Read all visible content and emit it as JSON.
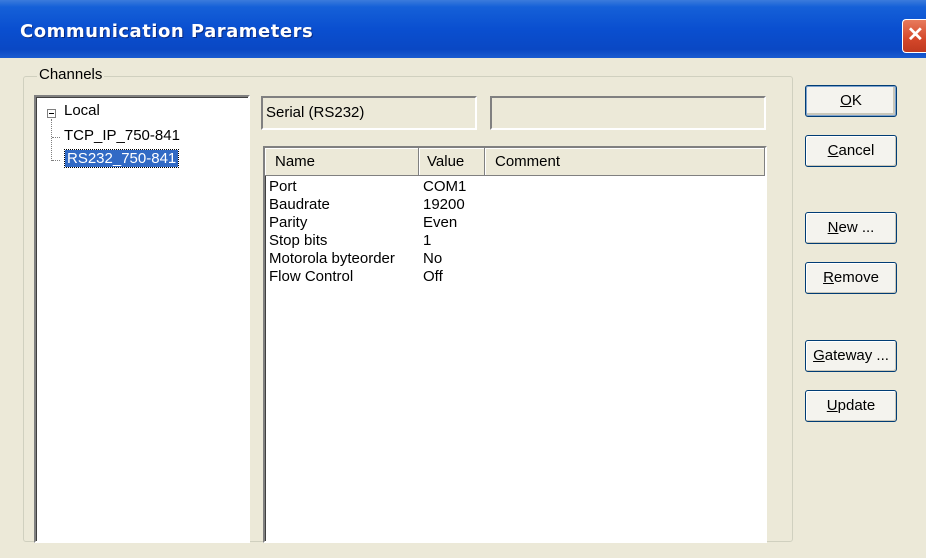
{
  "window": {
    "title": "Communication Parameters"
  },
  "channels": {
    "legend": "Channels",
    "tree": [
      {
        "label": "Local",
        "level": 0,
        "expanded": true
      },
      {
        "label": "TCP_IP_750-841",
        "level": 1
      },
      {
        "label": "RS232_750-841",
        "level": 1,
        "selected": true
      }
    ]
  },
  "detail": {
    "channel_type": "Serial (RS232)",
    "channel_info": "",
    "columns": [
      "Name",
      "Value",
      "Comment"
    ],
    "rows": [
      {
        "name": "Port",
        "value": "COM1",
        "comment": ""
      },
      {
        "name": "Baudrate",
        "value": "19200",
        "comment": ""
      },
      {
        "name": "Parity",
        "value": "Even",
        "comment": ""
      },
      {
        "name": "Stop bits",
        "value": "1",
        "comment": ""
      },
      {
        "name": "Motorola byteorder",
        "value": "No",
        "comment": ""
      },
      {
        "name": "Flow Control",
        "value": "Off",
        "comment": ""
      }
    ]
  },
  "buttons": {
    "ok": {
      "mnemonic": "O",
      "rest": "K"
    },
    "cancel": {
      "mnemonic": "C",
      "rest": "ancel"
    },
    "new": {
      "mnemonic": "N",
      "rest": "ew ..."
    },
    "remove": {
      "mnemonic": "R",
      "rest": "emove"
    },
    "gateway": {
      "mnemonic": "G",
      "rest": "ateway ..."
    },
    "update": {
      "mnemonic": "U",
      "rest": "pdate"
    }
  },
  "icons": {
    "close": "close-icon",
    "expander": "collapse-icon"
  }
}
